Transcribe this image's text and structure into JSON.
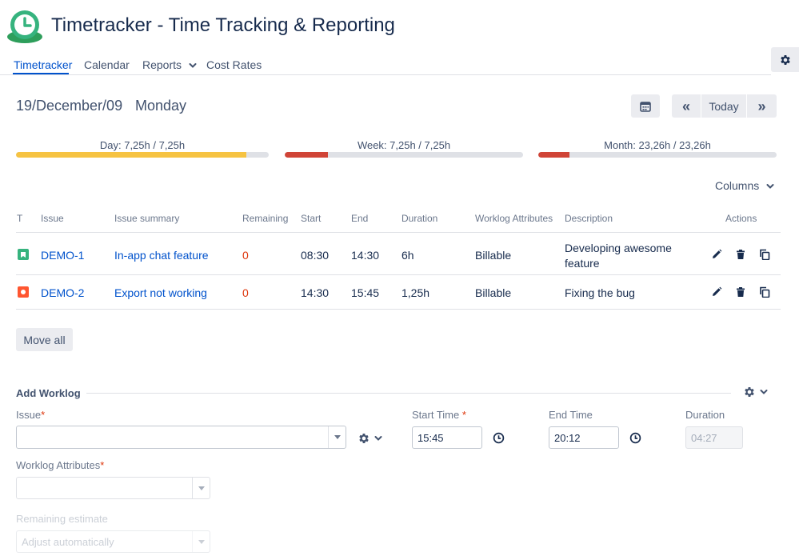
{
  "header": {
    "title": "Timetracker - Time Tracking & Reporting",
    "nav": [
      "Timetracker",
      "Calendar",
      "Reports",
      "Cost Rates"
    ]
  },
  "date_bar": {
    "date": "19/December/09",
    "weekday": "Monday",
    "today_label": "Today",
    "prev_label": "«",
    "next_label": "»"
  },
  "progress": [
    {
      "label": "Day: 7,25h / 7,25h",
      "fraction": 1.0,
      "color": "#f6c342"
    },
    {
      "label": "Week: 7,25h / 7,25h",
      "fraction": 0.18,
      "color": "#d04437"
    },
    {
      "label": "Month: 23,26h / 23,26h",
      "fraction": 0.13,
      "color": "#d04437"
    }
  ],
  "columns_label": "Columns",
  "table": {
    "headers": [
      "T",
      "Issue",
      "Issue summary",
      "Remaining",
      "Start",
      "End",
      "Duration",
      "Worklog Attributes",
      "Description",
      "Actions"
    ],
    "rows": [
      {
        "type": "story",
        "issue": "DEMO-1",
        "summary": "In-app chat feature",
        "remaining": "0",
        "start": "08:30",
        "end": "14:30",
        "duration": "6h",
        "attributes": "Billable",
        "description_line1": "Developing awesome",
        "description_line2": "feature"
      },
      {
        "type": "bug",
        "issue": "DEMO-2",
        "summary": "Export not working",
        "remaining": "0",
        "start": "14:30",
        "end": "15:45",
        "duration": "1,25h",
        "attributes": "Billable",
        "description_line1": "Fixing the bug",
        "description_line2": ""
      }
    ]
  },
  "move_all_label": "Move all",
  "add_worklog": {
    "title": "Add Worklog",
    "issue_label": "Issue",
    "start_label": "Start Time",
    "start_value": "15:45",
    "end_label": "End Time",
    "end_value": "20:12",
    "duration_label": "Duration",
    "duration_value": "04:27",
    "attributes_label": "Worklog Attributes",
    "remaining_label": "Remaining estimate",
    "remaining_value": "Adjust automatically",
    "required_mark": "*"
  },
  "colors": {
    "accent": "#0052cc",
    "story": "#36b37e",
    "bug": "#ff5630",
    "remaining_red": "#de350b"
  }
}
